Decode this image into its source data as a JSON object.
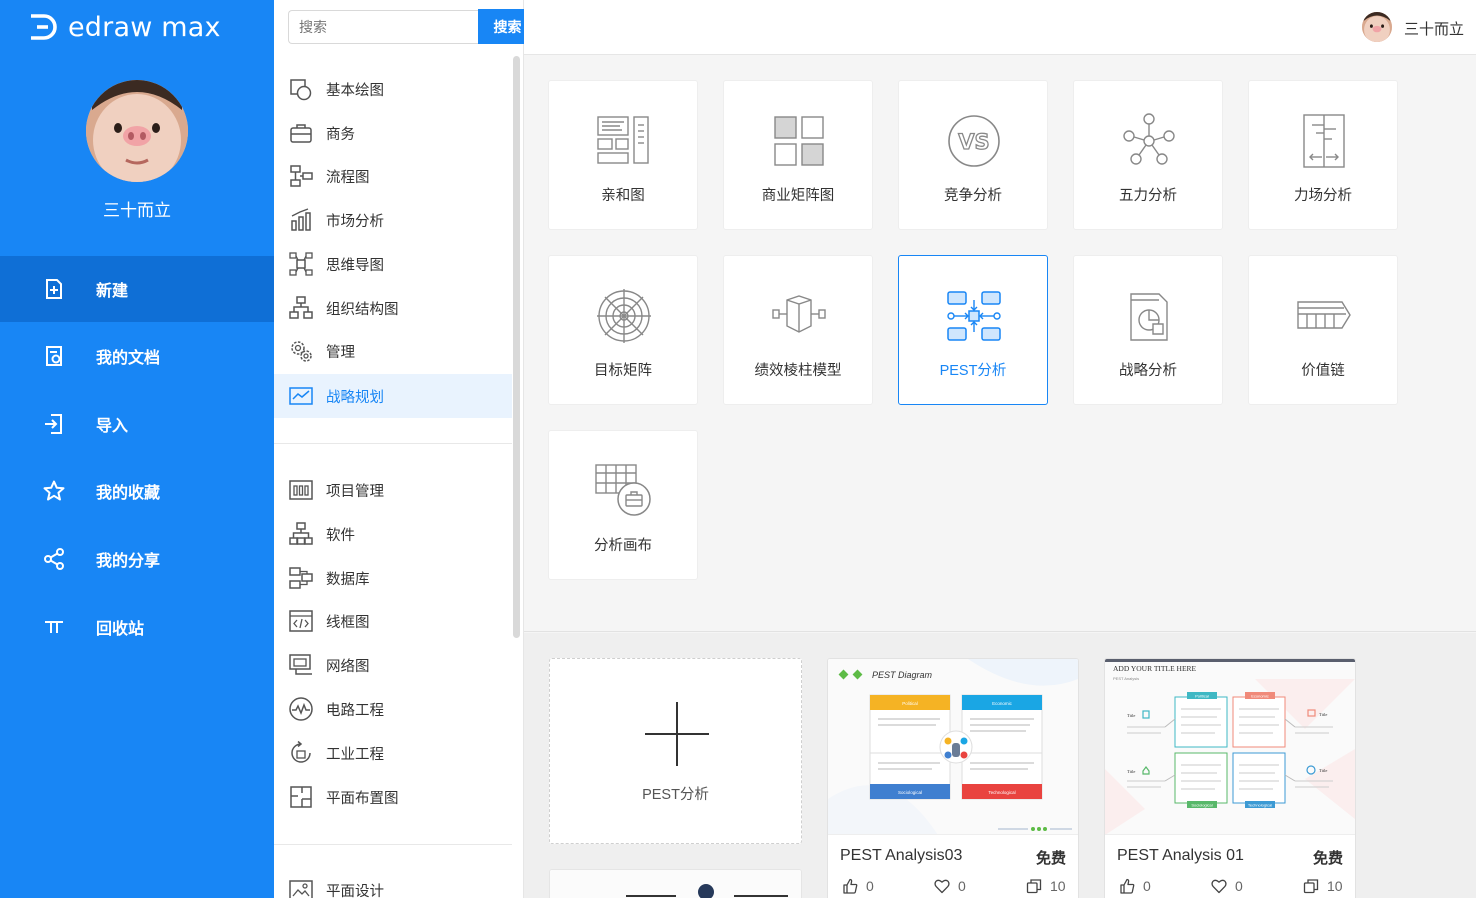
{
  "app": {
    "logo_text": "edraw max"
  },
  "user": {
    "name": "三十而立"
  },
  "sidebar": {
    "items": [
      {
        "label": "新建",
        "icon": "file-plus-icon"
      },
      {
        "label": "我的文档",
        "icon": "document-icon"
      },
      {
        "label": "导入",
        "icon": "import-icon"
      },
      {
        "label": "我的收藏",
        "icon": "star-icon"
      },
      {
        "label": "我的分享",
        "icon": "share-icon"
      },
      {
        "label": "回收站",
        "icon": "recycle-bin-icon"
      }
    ],
    "active_index": 0
  },
  "search": {
    "placeholder": "搜索",
    "button_label": "搜索"
  },
  "categories": {
    "group1": [
      "基本绘图",
      "商务",
      "流程图",
      "市场分析",
      "思维导图",
      "组织结构图",
      "管理",
      "战略规划"
    ],
    "group2": [
      "项目管理",
      "软件",
      "数据库",
      "线框图",
      "网络图",
      "电路工程",
      "工业工程",
      "平面布置图"
    ],
    "group3": [
      "平面设计"
    ],
    "active": "战略规划"
  },
  "templates": [
    {
      "label": "亲和图",
      "icon": "affinity-diagram-icon"
    },
    {
      "label": "商业矩阵图",
      "icon": "business-matrix-icon"
    },
    {
      "label": "竞争分析",
      "icon": "vs-icon"
    },
    {
      "label": "五力分析",
      "icon": "five-forces-icon"
    },
    {
      "label": "力场分析",
      "icon": "force-field-icon"
    },
    {
      "label": "目标矩阵",
      "icon": "target-matrix-icon"
    },
    {
      "label": "绩效棱柱模型",
      "icon": "prism-icon"
    },
    {
      "label": "PEST分析",
      "icon": "pest-icon"
    },
    {
      "label": "战略分析",
      "icon": "strategy-analysis-icon"
    },
    {
      "label": "价值链",
      "icon": "value-chain-icon"
    },
    {
      "label": "分析画布",
      "icon": "analysis-canvas-icon"
    }
  ],
  "selected_template": "PEST分析",
  "new_card": {
    "label": "PEST分析"
  },
  "examples": [
    {
      "title": "PEST Analysis03",
      "price": "免费",
      "likes": "0",
      "favorites": "0",
      "copies": "10",
      "thumb": {
        "heading": "PEST Diagram",
        "boxes": [
          "Political",
          "Economic",
          "Sociological",
          "Technological"
        ],
        "colors": [
          "#f5b324",
          "#1aa6e4",
          "#3f7fd0",
          "#e9433f"
        ]
      }
    },
    {
      "title": "PEST Analysis 01",
      "price": "免费",
      "likes": "0",
      "favorites": "0",
      "copies": "10",
      "thumb": {
        "heading": "ADD YOUR TITLE HERE",
        "subheading": "PEST Analysis",
        "boxes": [
          "Political",
          "Economic",
          "Sociological",
          "Technological"
        ],
        "side_label": "Title",
        "colors": [
          "#3fb8c4",
          "#f08a7a",
          "#58b86a",
          "#3c9ad4"
        ]
      }
    }
  ]
}
